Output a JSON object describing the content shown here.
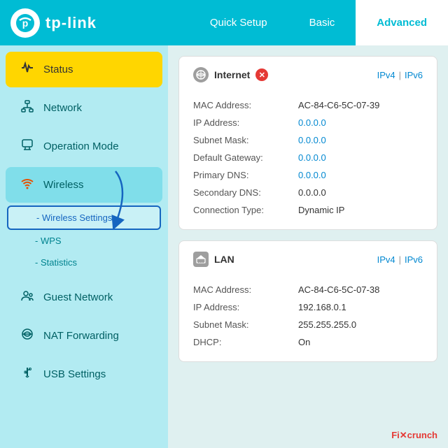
{
  "header": {
    "logo_text": "tp-link",
    "tabs": [
      {
        "label": "Quick Setup",
        "active": false
      },
      {
        "label": "Basic",
        "active": false
      },
      {
        "label": "Advanced",
        "active": true
      }
    ]
  },
  "sidebar": {
    "items": [
      {
        "label": "Status",
        "icon": "pulse",
        "active": true,
        "expanded": false
      },
      {
        "label": "Network",
        "icon": "network",
        "active": false,
        "expanded": false
      },
      {
        "label": "Operation Mode",
        "icon": "operation",
        "active": false,
        "expanded": false
      },
      {
        "label": "Wireless",
        "icon": "wifi",
        "active": false,
        "expanded": true
      },
      {
        "label": "Guest Network",
        "icon": "guest",
        "active": false,
        "expanded": false
      },
      {
        "label": "NAT Forwarding",
        "icon": "nat",
        "active": false,
        "expanded": false
      },
      {
        "label": "USB Settings",
        "icon": "usb",
        "active": false,
        "expanded": false
      }
    ],
    "sub_items": [
      {
        "label": "- Wireless Settings",
        "active": true
      },
      {
        "label": "- WPS",
        "active": false
      },
      {
        "label": "- Statistics",
        "active": false
      }
    ]
  },
  "internet_card": {
    "title": "Internet",
    "ipv4_label": "IPv4",
    "ipv6_label": "IPv6",
    "rows": [
      {
        "label": "MAC Address:",
        "value": "AC-84-C6-5C-07-39",
        "blue": false
      },
      {
        "label": "IP Address:",
        "value": "0.0.0.0",
        "blue": true
      },
      {
        "label": "Subnet Mask:",
        "value": "0.0.0.0",
        "blue": true
      },
      {
        "label": "Default Gateway:",
        "value": "0.0.0.0",
        "blue": true
      },
      {
        "label": "Primary DNS:",
        "value": "0.0.0.0",
        "blue": true
      },
      {
        "label": "Secondary DNS:",
        "value": "0.0.0.0",
        "blue": false
      },
      {
        "label": "Connection Type:",
        "value": "Dynamic IP",
        "blue": false
      }
    ]
  },
  "lan_card": {
    "title": "LAN",
    "ipv4_label": "IPv4",
    "ipv6_label": "IPv6",
    "rows": [
      {
        "label": "MAC Address:",
        "value": "AC-84-C6-5C-07-38",
        "blue": false
      },
      {
        "label": "IP Address:",
        "value": "192.168.0.1",
        "blue": false
      },
      {
        "label": "Subnet Mask:",
        "value": "255.255.255.0",
        "blue": false
      },
      {
        "label": "DHCP:",
        "value": "On",
        "blue": false
      }
    ]
  },
  "watermark": {
    "prefix": "Fi",
    "cross": "✕",
    "suffix": "crunch"
  }
}
